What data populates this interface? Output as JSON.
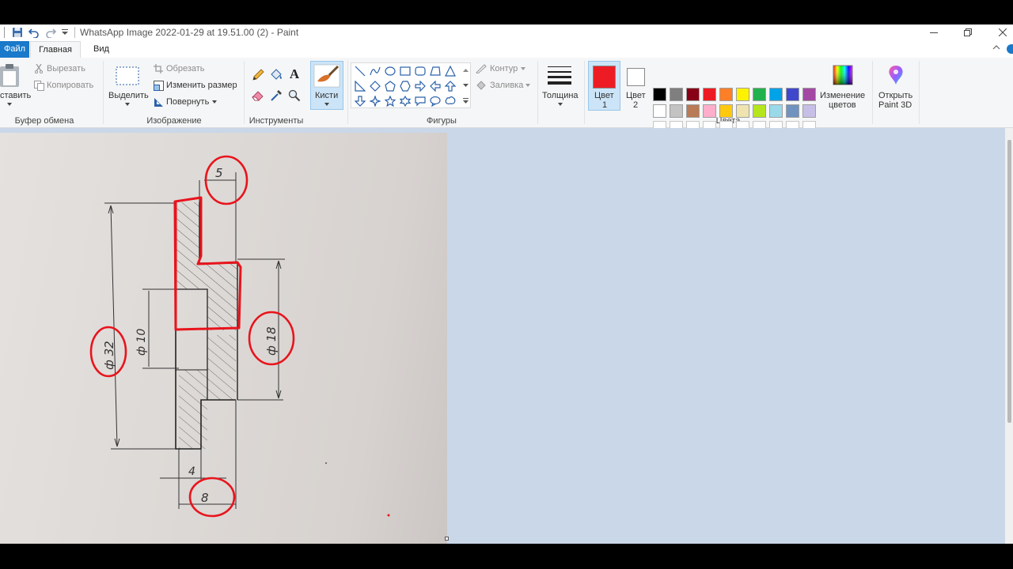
{
  "window": {
    "title": "WhatsApp Image 2022-01-29 at 19.51.00 (2) - Paint"
  },
  "menu": {
    "file": "Файл",
    "home": "Главная",
    "view": "Вид"
  },
  "clipboard": {
    "paste": "ставить",
    "cut": "Вырезать",
    "copy": "Копировать",
    "group": "Буфер обмена"
  },
  "image": {
    "select": "Выделить",
    "crop": "Обрезать",
    "resize": "Изменить размер",
    "rotate": "Повернуть",
    "group": "Изображение"
  },
  "tools": {
    "group": "Инструменты"
  },
  "brushes": {
    "label": "Кисти"
  },
  "shapes": {
    "outline": "Контур",
    "fill": "Заливка",
    "group": "Фигуры"
  },
  "size": {
    "label": "Толщина"
  },
  "colors": {
    "color1_label_a": "Цвет",
    "color1_label_b": "1",
    "color2_label_a": "Цвет",
    "color2_label_b": "2",
    "edit_a": "Изменение",
    "edit_b": "цветов",
    "group": "Цвета",
    "color1": "#ed1c24",
    "color2": "#ffffff",
    "palette_row1": [
      "#000000",
      "#7f7f7f",
      "#880015",
      "#ed1c24",
      "#ff7f27",
      "#fff200",
      "#22b14c",
      "#00a2e8",
      "#3f48cc",
      "#a349a4"
    ],
    "palette_row2": [
      "#ffffff",
      "#c3c3c3",
      "#b97a57",
      "#ffaec9",
      "#ffc90e",
      "#efe4b0",
      "#b5e61d",
      "#99d9ea",
      "#7092be",
      "#c8bfe7"
    ]
  },
  "paint3d": {
    "label_a": "Открыть",
    "label_b": "Paint 3D"
  },
  "drawing": {
    "dim_top": "5",
    "dim_phi32": "ф 32",
    "dim_phi10": "ф 10",
    "dim_phi18": "ф 18",
    "dim_4": "4",
    "dim_8": "8"
  }
}
